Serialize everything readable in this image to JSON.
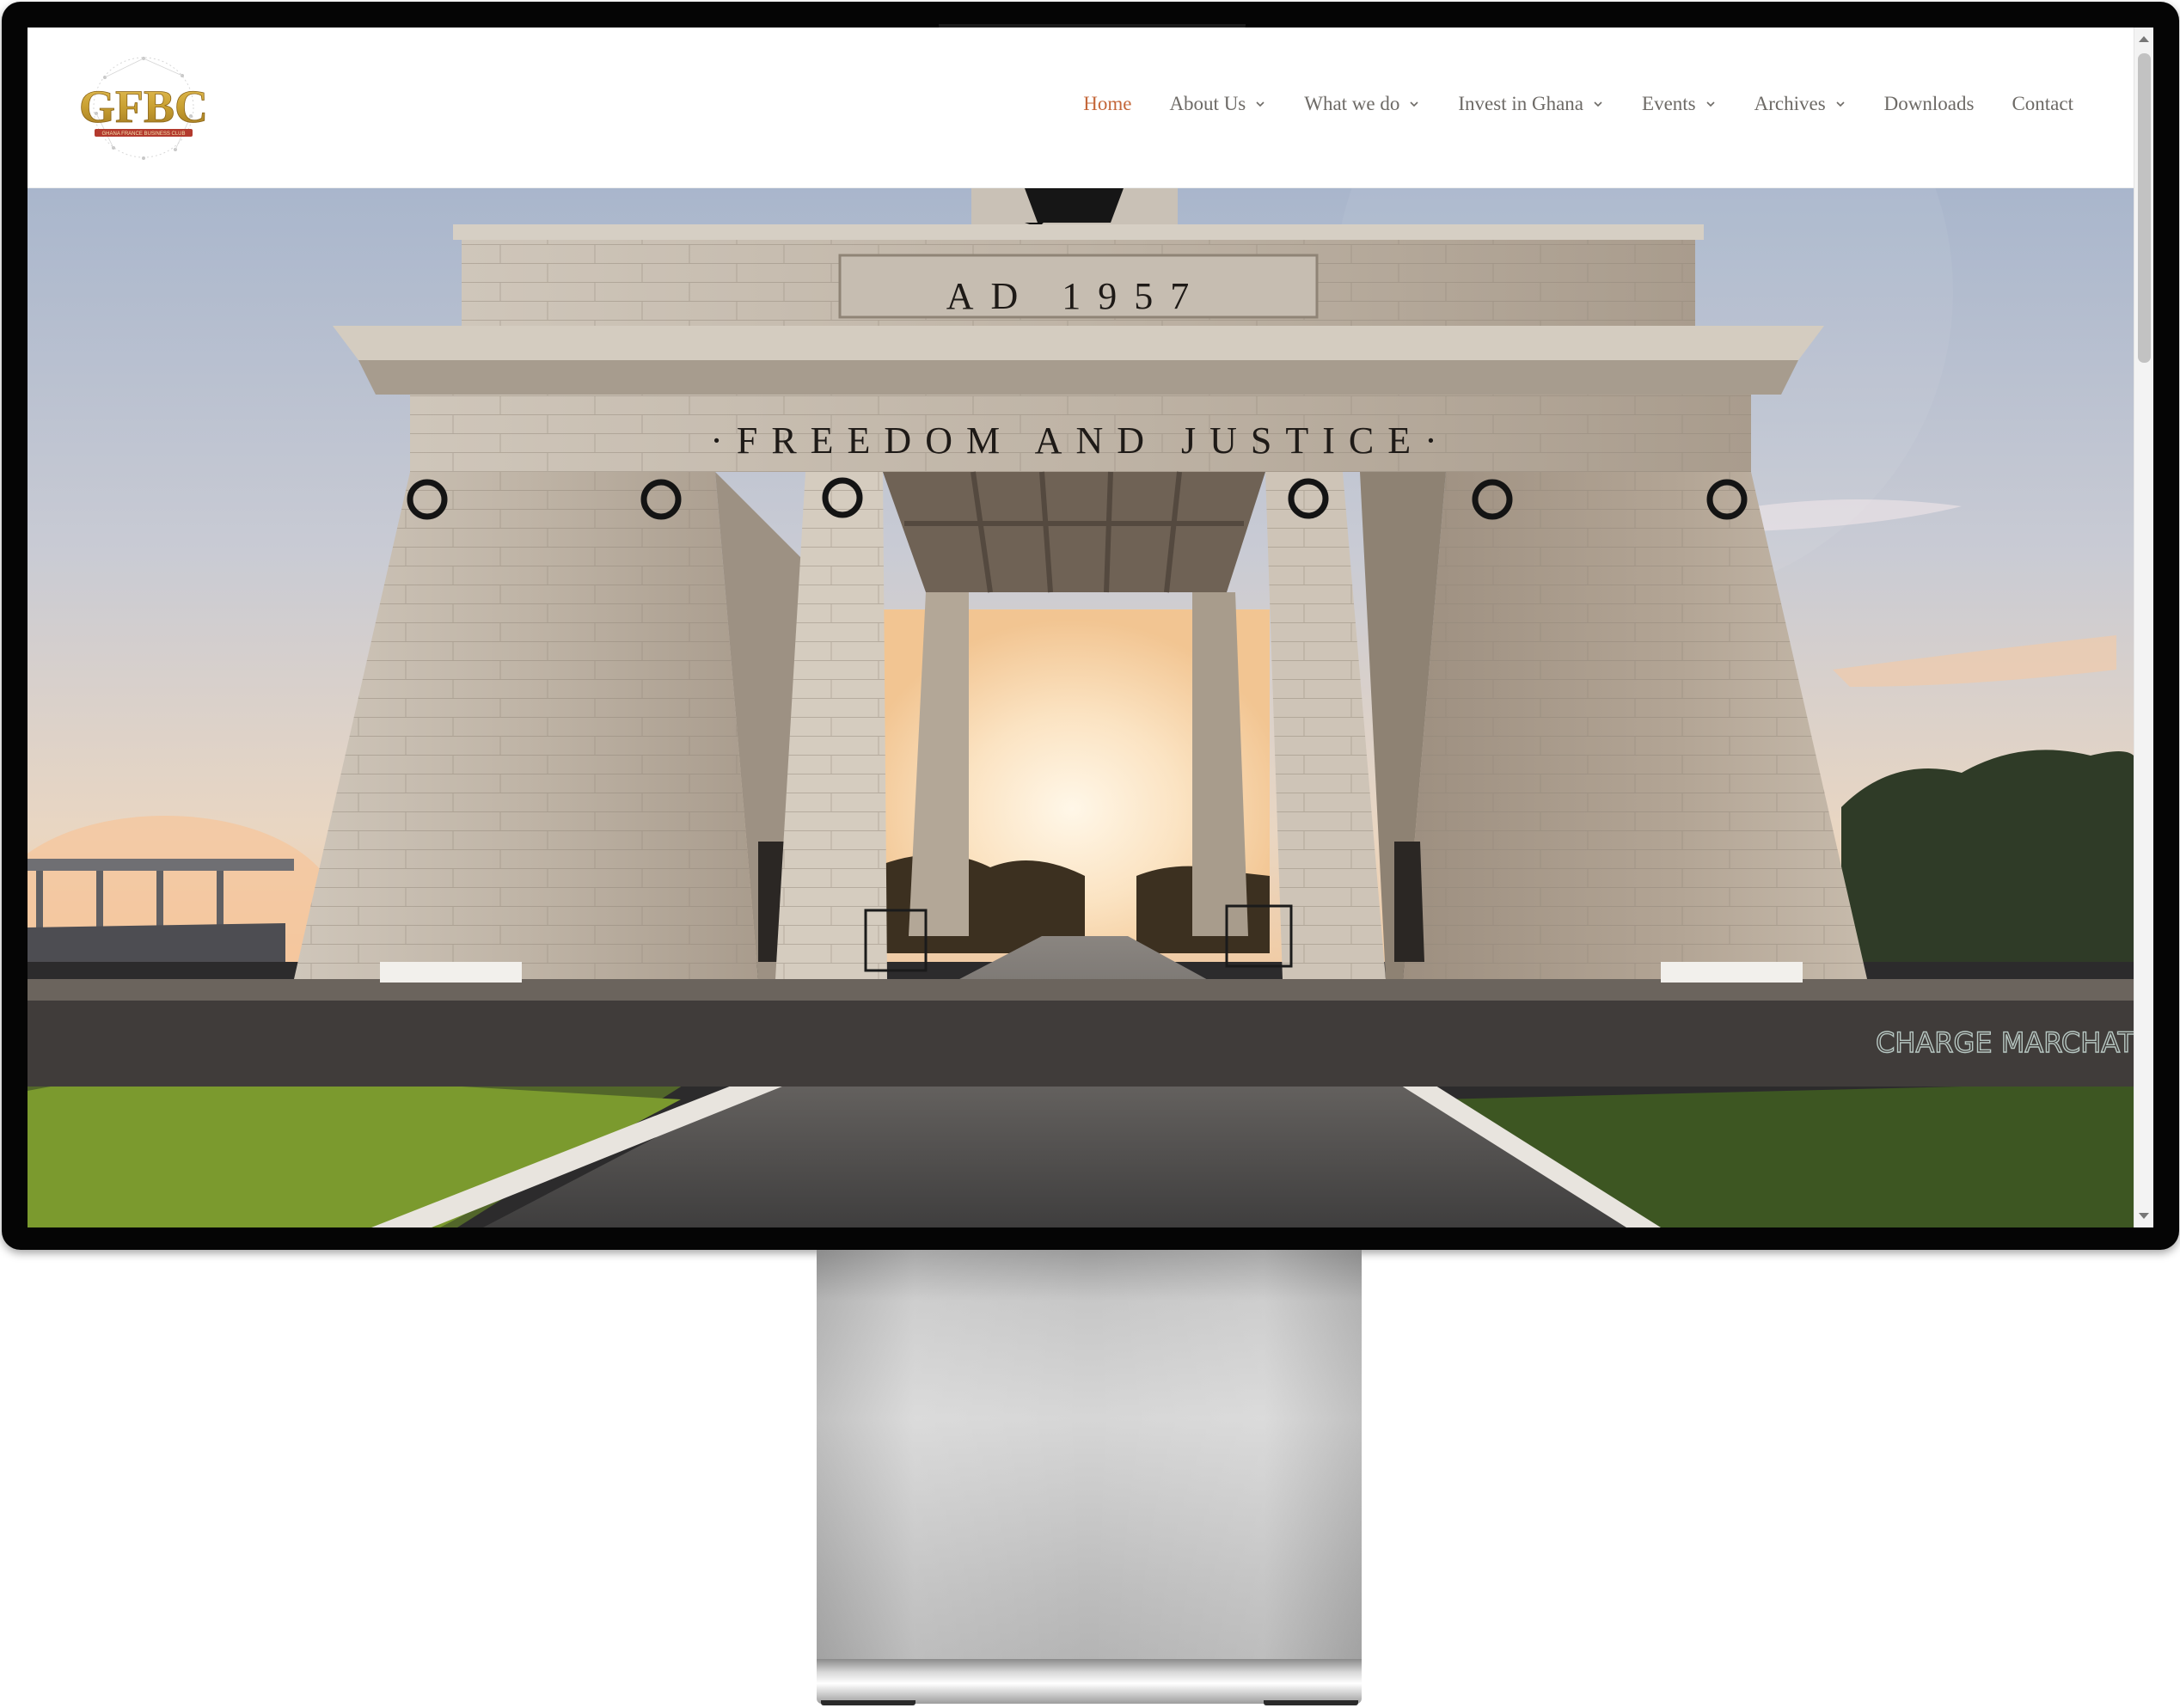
{
  "site": {
    "logo_text": "GFBC",
    "logo_tagline": "GHANA FRANCE BUSINESS CLUB"
  },
  "nav": {
    "items": [
      {
        "label": "Home",
        "active": true,
        "has_dropdown": false
      },
      {
        "label": "About Us",
        "active": false,
        "has_dropdown": true
      },
      {
        "label": "What we do",
        "active": false,
        "has_dropdown": true
      },
      {
        "label": "Invest in Ghana",
        "active": false,
        "has_dropdown": true
      },
      {
        "label": "Events",
        "active": false,
        "has_dropdown": true
      },
      {
        "label": "Archives",
        "active": false,
        "has_dropdown": true
      },
      {
        "label": "Downloads",
        "active": false,
        "has_dropdown": false
      },
      {
        "label": "Contact",
        "active": false,
        "has_dropdown": false
      }
    ]
  },
  "hero": {
    "inscription_top": "AD 1957",
    "inscription_main": "·FREEDOM AND JUSTICE·",
    "graffiti": "CHARGE MARCHAT"
  },
  "colors": {
    "nav_active": "#c4673a",
    "nav_text": "#6d6a66",
    "logo_gold": "#c9a032",
    "logo_red": "#b33a2e"
  },
  "icons": {
    "dropdown": "chevron-down-icon",
    "scroll_up": "scroll-up-arrow",
    "scroll_down": "scroll-down-arrow"
  }
}
